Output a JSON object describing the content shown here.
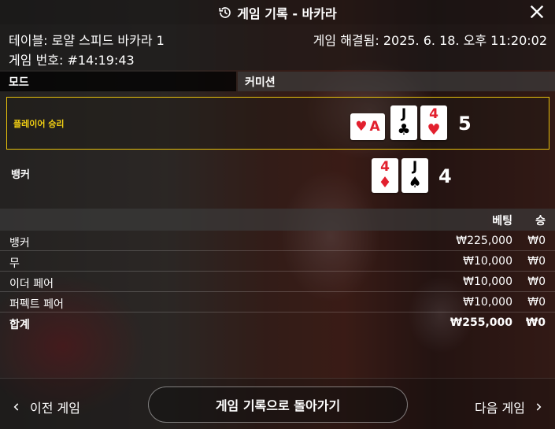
{
  "title": "게임 기록 - 바카라",
  "info": {
    "table": "테이블: 로얄 스피드 바카라 1",
    "resolved": "게임 해결됨: 2025. 6. 18. 오후 11:20:02",
    "game_number": "게임 번호: #14:19:43"
  },
  "mode_header": {
    "mode": "모드",
    "commission": "커미션"
  },
  "player": {
    "label": "플레이어 승리",
    "cards": [
      {
        "rank": "A",
        "suit": "♥",
        "color": "red",
        "orientation": "sideways"
      },
      {
        "rank": "J",
        "suit": "♣",
        "color": "black"
      },
      {
        "rank": "4",
        "suit": "♥",
        "color": "red"
      }
    ],
    "score": "5"
  },
  "banker": {
    "label": "뱅커",
    "cards": [
      {
        "rank": "4",
        "suit": "♦",
        "color": "red"
      },
      {
        "rank": "J",
        "suit": "♠",
        "color": "black"
      }
    ],
    "score": "4"
  },
  "bets_table": {
    "headers": {
      "bet": "베팅",
      "win": "승"
    },
    "rows": [
      {
        "name": "뱅커",
        "bet": "₩225,000",
        "win": "₩0"
      },
      {
        "name": "무",
        "bet": "₩10,000",
        "win": "₩0"
      },
      {
        "name": "이더 페어",
        "bet": "₩10,000",
        "win": "₩0"
      },
      {
        "name": "퍼펙트 페어",
        "bet": "₩10,000",
        "win": "₩0"
      }
    ],
    "total": {
      "name": "합계",
      "bet": "₩255,000",
      "win": "₩0"
    }
  },
  "footer": {
    "prev": "이전 게임",
    "back": "게임 기록으로 돌아가기",
    "next": "다음 게임"
  },
  "colors": {
    "accent": "#e7c10c",
    "red_suit": "#e2202e"
  },
  "icons": [
    "history-icon",
    "close-icon",
    "chevron-left-icon",
    "chevron-right-icon"
  ]
}
